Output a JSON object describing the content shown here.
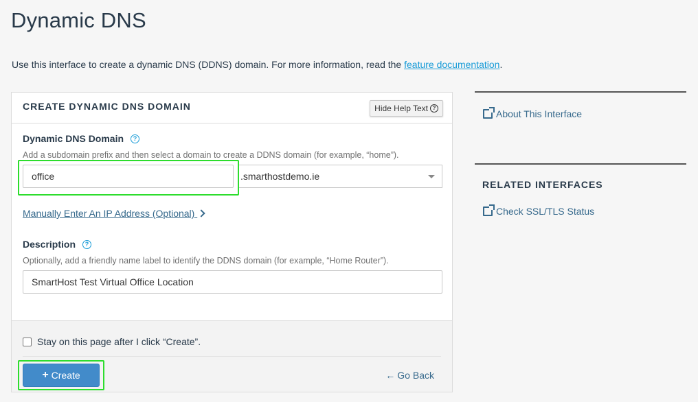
{
  "page": {
    "title": "Dynamic DNS",
    "intro_text": "Use this interface to create a dynamic DNS (DDNS) domain. For more information, read the ",
    "intro_link": "feature documentation",
    "intro_end": "."
  },
  "form": {
    "header": "CREATE DYNAMIC DNS DOMAIN",
    "help_toggle_label": "Hide Help Text",
    "domain": {
      "label": "Dynamic DNS Domain",
      "help": "Add a subdomain prefix and then select a domain to create a DDNS domain (for example, “home”).",
      "prefix_value": "office",
      "selected_domain": ".smarthostdemo.ie"
    },
    "manual_ip_link": "Manually Enter An IP Address (Optional)",
    "description": {
      "label": "Description",
      "help": "Optionally, add a friendly name label to identify the DDNS domain (for example, “Home Router”).",
      "value": "SmartHost Test Virtual Office Location"
    },
    "stay_checkbox_label": "Stay on this page after I click “Create”.",
    "create_button": "Create",
    "go_back": "Go Back"
  },
  "sidebar": {
    "about_link": "About This Interface",
    "related_heading": "RELATED INTERFACES",
    "related_links": [
      "Check SSL/TLS Status"
    ]
  },
  "colors": {
    "primary_button": "#428bca",
    "link": "#36698c",
    "highlight": "#2ddd2d"
  }
}
